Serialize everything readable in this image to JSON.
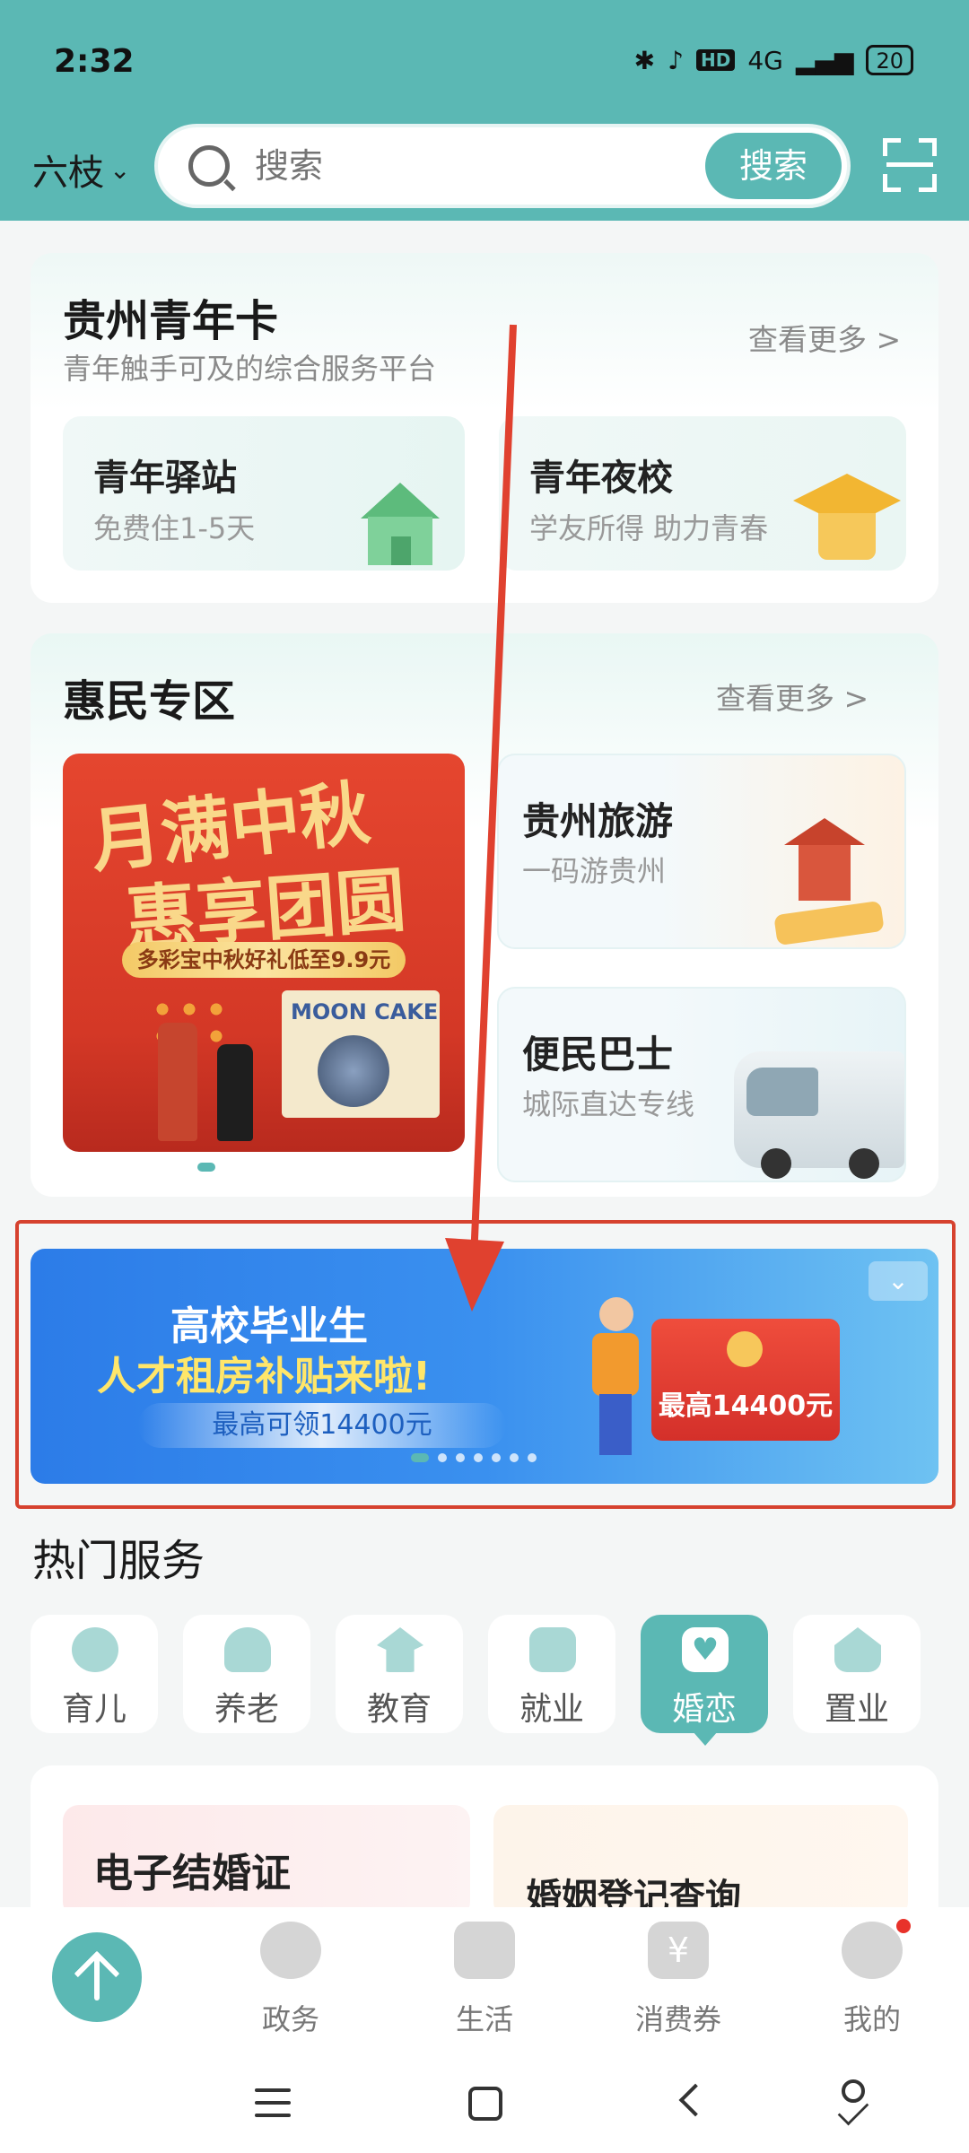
{
  "status_bar": {
    "time": "2:32",
    "network": "4G",
    "hd_label": "HD",
    "battery": "20"
  },
  "header": {
    "location": "六枝",
    "search_placeholder": "搜索",
    "search_button": "搜索"
  },
  "youth_card": {
    "title": "贵州青年卡",
    "subtitle": "青年触手可及的综合服务平台",
    "more": "查看更多 >",
    "tiles": [
      {
        "title": "青年驿站",
        "subtitle": "免费住1-5天"
      },
      {
        "title": "青年夜校",
        "subtitle": "学友所得 助力青春"
      }
    ]
  },
  "benefit_card": {
    "title": "惠民专区",
    "more": "查看更多 >",
    "promo": {
      "line1": "月满中秋",
      "line2": "惠享团圆",
      "tag": "多彩宝中秋好礼低至9.9元",
      "box_text": "MOON CAKE"
    },
    "tiles": [
      {
        "title": "贵州旅游",
        "subtitle": "一码游贵州"
      },
      {
        "title": "便民巴士",
        "subtitle": "城际直达专线"
      }
    ]
  },
  "banner": {
    "line1": "高校毕业生",
    "line2": "人才租房补贴来啦!",
    "pill": "最高可领14400元",
    "redpacket": "最高14400元",
    "collapse": "⌄"
  },
  "hot_services": {
    "title": "热门服务",
    "items": [
      {
        "label": "育儿",
        "icon": "baby-icon"
      },
      {
        "label": "养老",
        "icon": "elder-icon"
      },
      {
        "label": "教育",
        "icon": "graduation-cap-icon"
      },
      {
        "label": "就业",
        "icon": "briefcase-icon"
      },
      {
        "label": "婚恋",
        "icon": "heart-icon",
        "active": true
      },
      {
        "label": "置业",
        "icon": "house-icon"
      }
    ]
  },
  "marriage": {
    "tile1": "电子结婚证",
    "tile2": "婚姻登记查询"
  },
  "bottom_nav": {
    "items": [
      {
        "label": "政务",
        "icon": "gov-icon"
      },
      {
        "label": "生活",
        "icon": "shop-icon"
      },
      {
        "label": "消费券",
        "icon": "coupon-icon"
      },
      {
        "label": "我的",
        "icon": "profile-icon"
      }
    ]
  },
  "colors": {
    "accent": "#5bb8b4",
    "annotation_red": "#d6422f"
  }
}
